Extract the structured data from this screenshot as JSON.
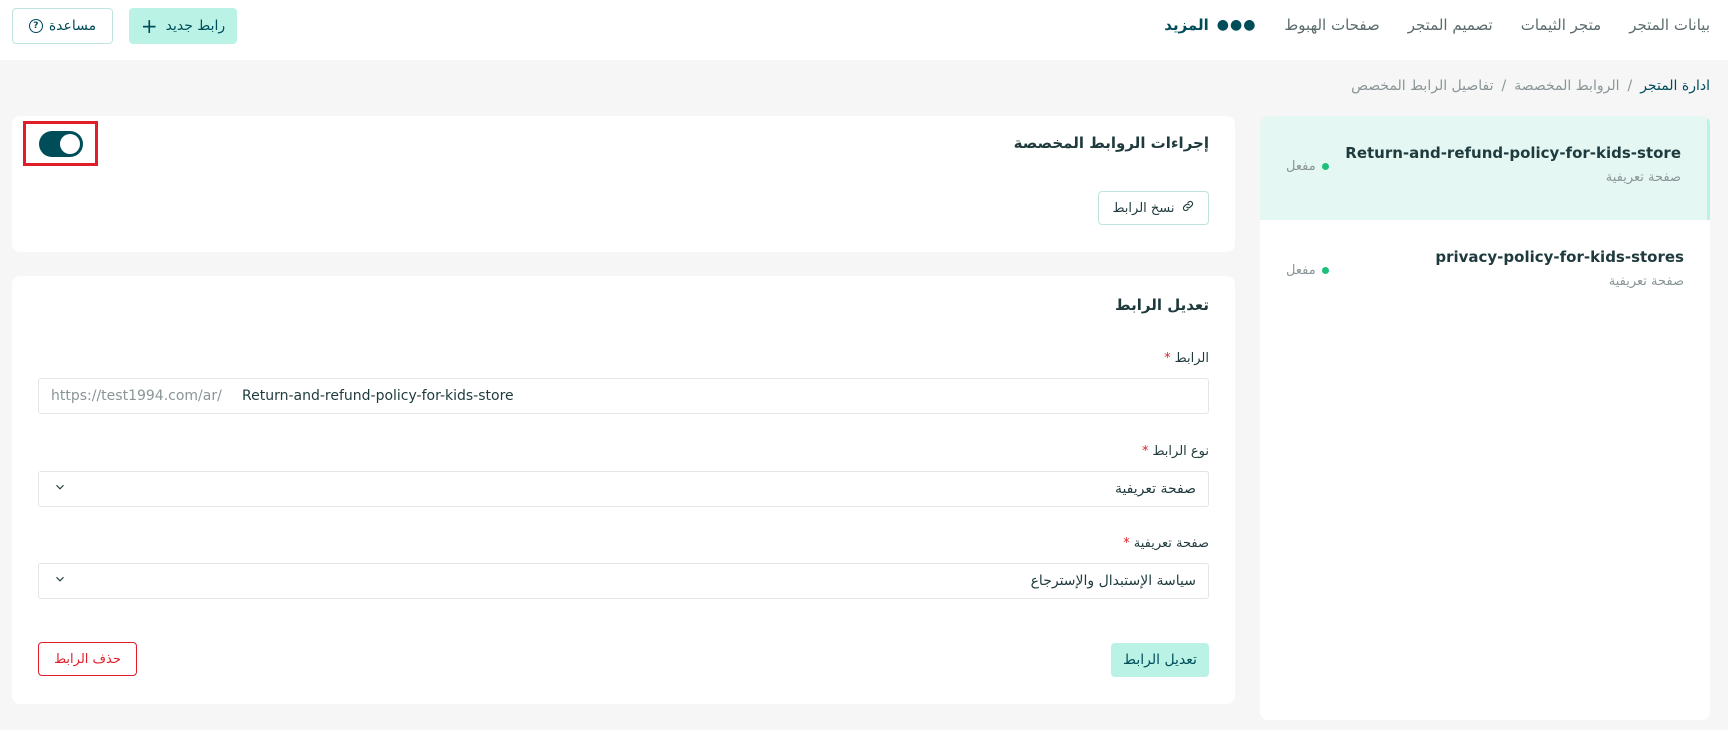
{
  "nav": {
    "items": [
      "بيانات المتجر",
      "متجر الثيمات",
      "تصميم المتجر",
      "صفحات الهبوط"
    ],
    "more_label": "المزيد"
  },
  "header": {
    "new_link_label": "رابط جديد",
    "help_label": "مساعدة"
  },
  "breadcrumb": {
    "items": [
      "ادارة المتجر",
      "الروابط المخصصة",
      "تفاصيل الرابط المخصص"
    ],
    "separator": "/"
  },
  "actions_card": {
    "title": "إجراءات الروابط المخصصة",
    "toggle_on": true,
    "copy_label": "نسخ الرابط"
  },
  "edit_card": {
    "title": "تعديل الرابط",
    "link_label": "الرابط",
    "link_prefix": "https://test1994.com/ar/",
    "link_value": "Return-and-refund-policy-for-kids-store",
    "type_label": "نوع الرابط",
    "type_value": "صفحة تعريفية",
    "page_label": "صفحة تعريفية",
    "page_value": "سياسة الإستبدال والإسترجاع",
    "required_mark": "*",
    "save_label": "تعديل الرابط",
    "delete_label": "حذف الرابط"
  },
  "links": [
    {
      "name": "Return-and-refund-policy-for-kids-store",
      "type": "صفحة تعريفية",
      "status": "مفعل",
      "active": true
    },
    {
      "name": "privacy-policy-for-kids-stores",
      "type": "صفحة تعريفية",
      "status": "مفعل",
      "active": false
    }
  ],
  "colors": {
    "primary": "#004d5a",
    "accent": "#baf3e6",
    "danger": "#e11d2a",
    "active_bg": "#e4f7f2",
    "status_dot": "#1fbf7a"
  }
}
